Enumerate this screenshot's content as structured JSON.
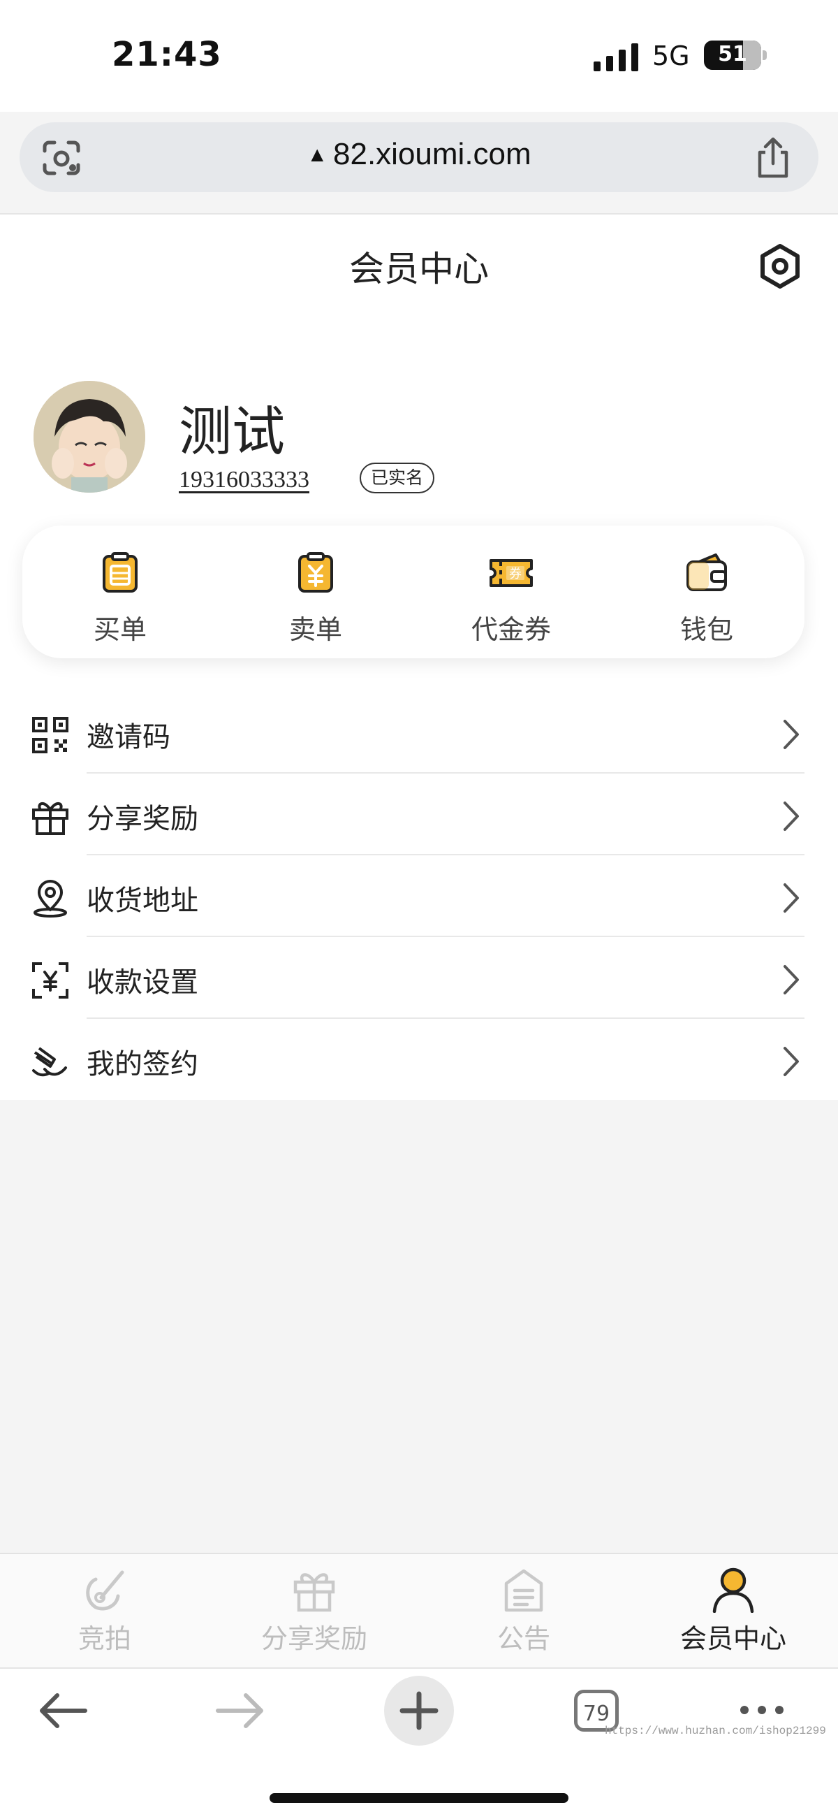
{
  "status_bar": {
    "time": "21:43",
    "network": "5G",
    "battery": "51"
  },
  "browser": {
    "url": "82.xioumi.com",
    "tab_count": "79",
    "watermark": "https://www.huzhan.com/ishop21299"
  },
  "header": {
    "title": "会员中心"
  },
  "profile": {
    "name": "测试",
    "phone": "19316033333",
    "verified_label": "已实名"
  },
  "quick_actions": [
    {
      "label": "买单",
      "icon": "buy-order-icon"
    },
    {
      "label": "卖单",
      "icon": "sell-order-icon"
    },
    {
      "label": "代金券",
      "icon": "voucher-icon"
    },
    {
      "label": "钱包",
      "icon": "wallet-icon"
    }
  ],
  "menu": [
    {
      "label": "邀请码",
      "icon": "qrcode-icon"
    },
    {
      "label": "分享奖励",
      "icon": "gift-icon"
    },
    {
      "label": "收货地址",
      "icon": "location-icon"
    },
    {
      "label": "收款设置",
      "icon": "payment-scan-icon"
    },
    {
      "label": "我的签约",
      "icon": "sign-icon"
    }
  ],
  "tabbar": [
    {
      "label": "竞拍",
      "icon": "auction-icon",
      "active": false
    },
    {
      "label": "分享奖励",
      "icon": "gift-icon",
      "active": false
    },
    {
      "label": "公告",
      "icon": "notice-icon",
      "active": false
    },
    {
      "label": "会员中心",
      "icon": "member-icon",
      "active": true
    }
  ],
  "colors": {
    "accent": "#f5b731",
    "inactive": "#bdbdbd",
    "text": "#222222"
  }
}
